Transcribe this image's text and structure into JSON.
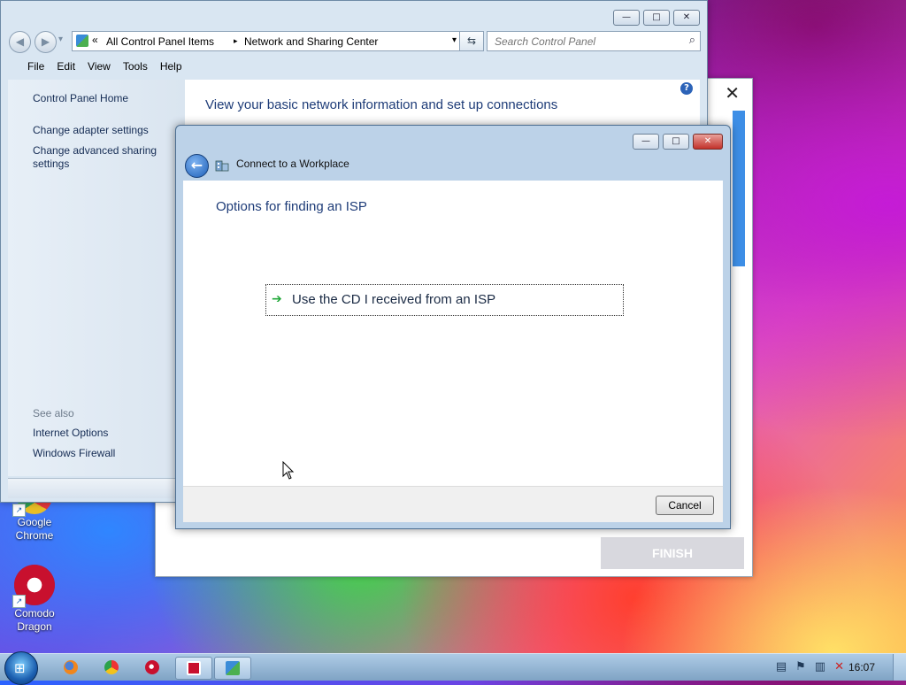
{
  "desktop": {
    "icons": [
      {
        "label_line1": "Google",
        "label_line2": "Chrome",
        "icon": "chrome-icon"
      },
      {
        "label_line1": "Comodo",
        "label_line2": "Dragon",
        "icon": "comodo-dragon-icon"
      }
    ]
  },
  "background_wizard": {
    "close_glyph": "✕",
    "finish_label": "FINISH"
  },
  "explorer": {
    "window_buttons": {
      "minimize": "—",
      "maximize": "□",
      "close": "✕"
    },
    "nav": {
      "back": "◀",
      "forward": "▶",
      "history": "▾"
    },
    "address": {
      "chevrons": "«",
      "crumb1": "All Control Panel Items",
      "separator": "▸",
      "crumb2": "Network and Sharing Center",
      "dropdown": "▾"
    },
    "refresh_glyph": "⇆",
    "search": {
      "placeholder": "Search Control Panel"
    },
    "menu": [
      "File",
      "Edit",
      "View",
      "Tools",
      "Help"
    ],
    "sidebar": {
      "home": "Control Panel Home",
      "adapter": "Change adapter settings",
      "advanced_line1": "Change advanced sharing",
      "advanced_line2": "settings",
      "see_also": "See also",
      "internet_options": "Internet Options",
      "firewall": "Windows Firewall"
    },
    "content_title": "View your basic network information and set up connections",
    "help_glyph": "?"
  },
  "dialog": {
    "title": "Connect to a Workplace",
    "window_buttons": {
      "minimize": "—",
      "maximize": "□",
      "close": "✕"
    },
    "back_glyph": "←",
    "heading": "Options for finding an ISP",
    "option": {
      "arrow": "➔",
      "label": "Use the CD I received from an ISP"
    },
    "cancel_label": "Cancel"
  },
  "taskbar": {
    "start_glyph": "⊞",
    "apps": [
      "firefox-icon",
      "chrome-icon",
      "media-player-icon",
      "comodo-icon",
      "control-panel-icon"
    ],
    "tray": [
      "action-center-icon",
      "flag-icon",
      "network-icon",
      "volume-muted-icon"
    ],
    "clock": "16:07"
  }
}
